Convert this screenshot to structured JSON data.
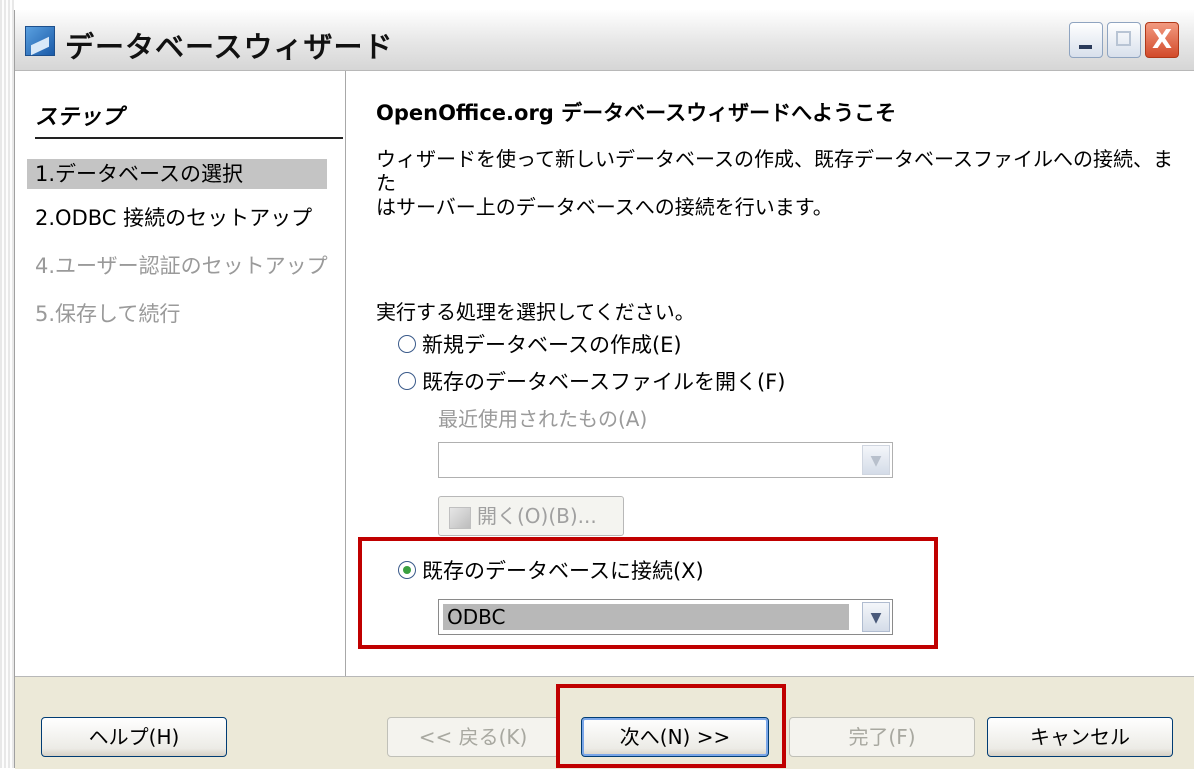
{
  "window": {
    "title": "データベースウィザード"
  },
  "title_buttons": {
    "close_glyph": "X"
  },
  "steps": {
    "header": "ステップ",
    "items": [
      {
        "label": "1.データベースの選択",
        "state": "active"
      },
      {
        "label": "2.ODBC 接続のセットアップ",
        "state": "normal"
      },
      {
        "label": "4.ユーザー認証のセットアップ",
        "state": "disabled"
      },
      {
        "label": "5.保存して続行",
        "state": "disabled"
      }
    ]
  },
  "main": {
    "heading": "OpenOffice.org データベースウィザードへようこそ",
    "description_line1": "ウィザードを使って新しいデータベースの作成、既存データベースファイルへの接続、また",
    "description_line2": "はサーバー上のデータベースへの接続を行います。",
    "prompt": "実行する処理を選択してください。",
    "options": [
      {
        "label": "新規データベースの作成(E)",
        "checked": false
      },
      {
        "label": "既存のデータベースファイルを開く(F)",
        "checked": false
      },
      {
        "label": "既存のデータベースに接続(X)",
        "checked": true
      }
    ],
    "recent_label": "最近使用されたもの(A)",
    "recent_value": "",
    "open_button": "開く(O)(B)...",
    "connection_type": "ODBC"
  },
  "footer": {
    "help": "ヘルプ(H)",
    "back": "<< 戻る(K)",
    "next": "次へ(N) >>",
    "finish": "完了(F)",
    "cancel": "キャンセル"
  },
  "colors": {
    "highlight": "#c00000",
    "window_bg": "#ece9d8"
  }
}
